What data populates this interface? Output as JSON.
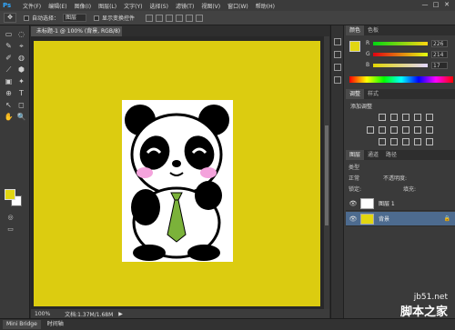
{
  "app": {
    "logo": "Ps"
  },
  "menubar": {
    "items": [
      "文件(F)",
      "编辑(E)",
      "图像(I)",
      "图层(L)",
      "文字(Y)",
      "选择(S)",
      "滤镜(T)",
      "视图(V)",
      "窗口(W)",
      "帮助(H)"
    ],
    "window_controls": [
      "—",
      "□",
      "✕"
    ]
  },
  "options": {
    "tool_glyph": "✥",
    "auto_select_label": "自动选择：",
    "auto_select_value": "图层",
    "show_transform_label": "显示变换控件"
  },
  "document": {
    "tab_title": "未标题-1 @ 100% (背景, RGB/8)",
    "zoom": "100%",
    "doc_info": "文档:1.37M/1.68M"
  },
  "toolbox": {
    "tools": [
      "▭",
      "◌",
      "✎",
      "⌖",
      "✐",
      "◍",
      "⟋",
      "⬢",
      "▣",
      "✦",
      "⊕",
      "T",
      "↖",
      "◻",
      "✋",
      "🔍"
    ]
  },
  "bridge": {
    "tabs": [
      "Mini Bridge",
      "时间轴"
    ]
  },
  "color_panel": {
    "tabs": [
      "颜色",
      "色板"
    ],
    "foreground": "#e2d611",
    "r": {
      "label": "R",
      "value": "226"
    },
    "g": {
      "label": "G",
      "value": "214"
    },
    "b": {
      "label": "B",
      "value": "17"
    }
  },
  "adjust_panel": {
    "tabs": [
      "调整",
      "样式"
    ],
    "title": "添加调整"
  },
  "layers_panel": {
    "tabs": [
      "图层",
      "通道",
      "路径"
    ],
    "filter_label": "类型",
    "blend_mode": "正常",
    "opacity_label": "不透明度:",
    "lock_label": "锁定:",
    "fill_label": "填充:",
    "layers": [
      {
        "name": "图层 1",
        "thumb_color": "#ffffff",
        "selected": false
      },
      {
        "name": "背景",
        "thumb_color": "#e2d611",
        "selected": true
      }
    ]
  },
  "colors": {
    "canvas": "#dccc10",
    "panda_cheek": "#f4a3dc",
    "panda_tie": "#7bb23a"
  },
  "watermark": {
    "site": "jb51.net",
    "brand": "脚本之家"
  }
}
